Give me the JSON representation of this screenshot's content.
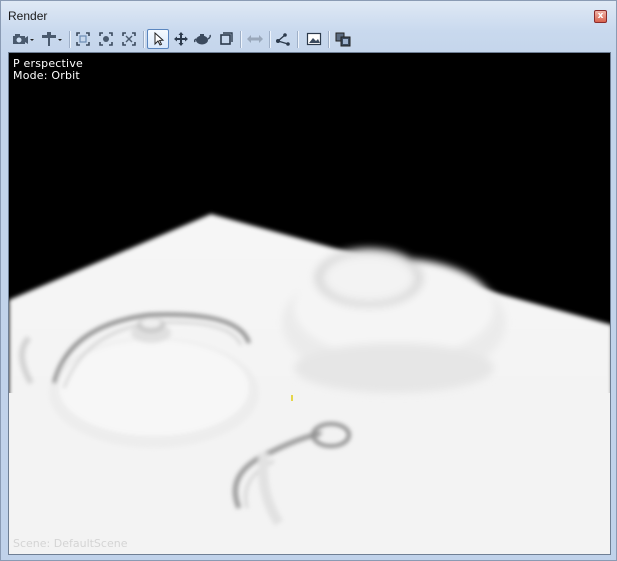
{
  "window": {
    "title": "Render",
    "close_glyph": "x"
  },
  "toolbar": {
    "items": [
      {
        "name": "camera-dropdown-button",
        "icon": "camera-icon"
      },
      {
        "name": "light-dropdown-button",
        "icon": "light-icon"
      },
      {
        "name": "frame-all-button",
        "icon": "frame-all-icon"
      },
      {
        "name": "frame-selected-button",
        "icon": "frame-selected-icon"
      },
      {
        "name": "zoom-extents-button",
        "icon": "zoom-extents-icon"
      },
      {
        "name": "select-tool-button",
        "icon": "cursor-arrow-icon",
        "active": true
      },
      {
        "name": "move-tool-button",
        "icon": "move-arrows-icon"
      },
      {
        "name": "rotate-tool-button",
        "icon": "rotate-teapot-icon"
      },
      {
        "name": "scale-tool-button",
        "icon": "scale-box-icon"
      },
      {
        "name": "transform-button",
        "icon": "transform-icon"
      },
      {
        "name": "node-link-button",
        "icon": "node-link-icon"
      },
      {
        "name": "image-button",
        "icon": "image-icon"
      },
      {
        "name": "layers-button",
        "icon": "layers-icon"
      }
    ]
  },
  "viewport": {
    "camera_label": "P erspective",
    "mode_label": "Mode: Orbit",
    "scene_label": "Scene: DefaultScene",
    "background_color": "#000000",
    "floor_color": "#f4f4f4"
  }
}
